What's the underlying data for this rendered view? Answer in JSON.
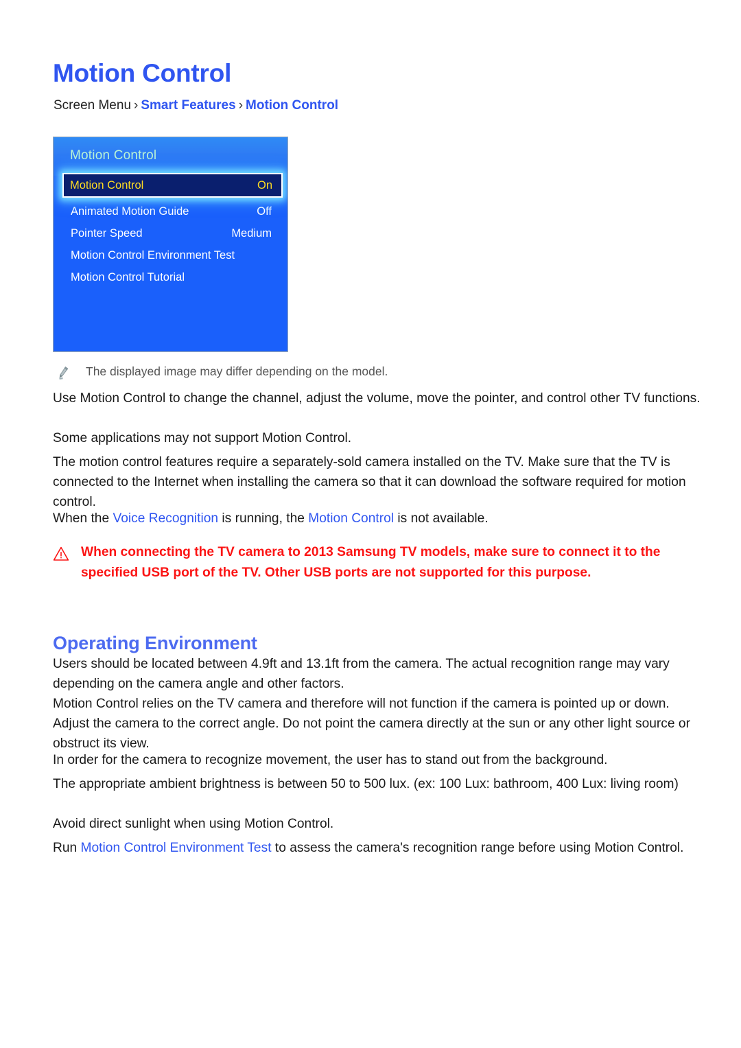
{
  "page_title": "Motion Control",
  "breadcrumb": {
    "root": "Screen Menu",
    "sep": "›",
    "level1": "Smart Features",
    "level2": "Motion Control"
  },
  "tv_menu": {
    "header_title": "Motion Control",
    "rows": [
      {
        "label": "Motion Control",
        "value": "On",
        "selected": true
      },
      {
        "label": "Animated Motion Guide",
        "value": "Off",
        "selected": false
      },
      {
        "label": "Pointer Speed",
        "value": "Medium",
        "selected": false
      },
      {
        "label": "Motion Control Environment Test",
        "value": "",
        "selected": false
      },
      {
        "label": "Motion Control Tutorial",
        "value": "",
        "selected": false
      }
    ],
    "colors": {
      "panel_background": "#1a60fb",
      "header_gradient_top": "#2f8bf5",
      "header_title_text": "#b9f3d5",
      "selected_row_background": "#0a1f6e",
      "selected_row_text": "#ffdd22",
      "selected_row_glow": "#78e1ff",
      "row_text": "#ffffff"
    }
  },
  "note": {
    "icon": "pencil-icon",
    "text": "The displayed image may differ depending on the model."
  },
  "paragraphs": {
    "p1": "Use Motion Control to change the channel, adjust the volume, move the pointer, and control other TV functions.",
    "p2": "Some applications may not support Motion Control.",
    "p3": "The motion control features require a separately-sold camera installed on the TV. Make sure that the TV is connected to the Internet when installing the camera so that it can download the software required for motion control.",
    "p4_a": "When the ",
    "p4_link1": "Voice Recognition",
    "p4_b": " is running, the ",
    "p4_link2": "Motion Control",
    "p4_c": " is not available."
  },
  "warning": {
    "icon": "warning-triangle-icon",
    "text": "When connecting the TV camera to 2013 Samsung TV models, make sure to connect it to the specified USB port of the TV. Other USB ports are not supported for this purpose.",
    "color": "#fb1414"
  },
  "operating_environment": {
    "heading": "Operating Environment",
    "p1": "Users should be located between 4.9ft and 13.1ft from the camera. The actual recognition range may vary depending on the camera angle and other factors.",
    "p2": "Motion Control relies on the TV camera and therefore will not function if the camera is pointed up or down. Adjust the camera to the correct angle. Do not point the camera directly at the sun or any other light source or obstruct its view.",
    "p3": "In order for the camera to recognize movement, the user has to stand out from the background.",
    "p4": "The appropriate ambient brightness is between 50 to 500 lux. (ex: 100 Lux: bathroom, 400 Lux: living room)",
    "p5": "Avoid direct sunlight when using Motion Control.",
    "p6_a": "Run ",
    "p6_link": "Motion Control Environment Test",
    "p6_b": " to assess the camera's recognition range before using Motion Control."
  },
  "colors": {
    "heading_blue": "#2f55f0",
    "section_blue": "#4d6bf0",
    "link_blue": "#2f55f0",
    "body_text": "#1a1a1a",
    "note_text": "#565656"
  }
}
